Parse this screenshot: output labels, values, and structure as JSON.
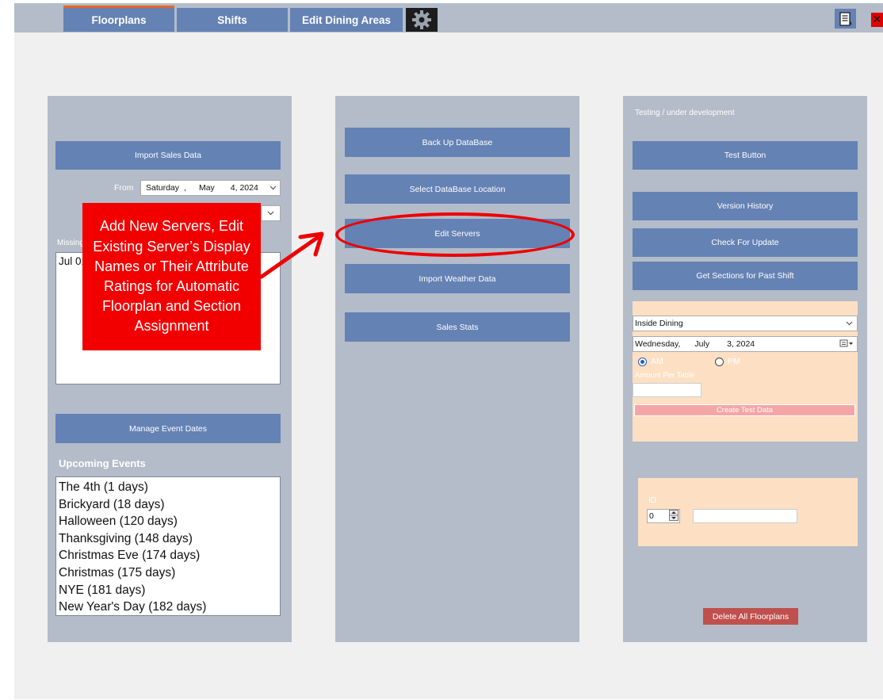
{
  "tabs": [
    {
      "label": "Floorplans"
    },
    {
      "label": "Shifts"
    },
    {
      "label": "Edit Dining Areas"
    }
  ],
  "icons": {
    "settings": "gear-icon",
    "notes": "notes-icon",
    "close": "close-icon"
  },
  "left_panel": {
    "import_button": "Import Sales Data",
    "from_label": "From",
    "from_date": {
      "weekday": "Saturday",
      "sep": ",",
      "month": "May",
      "day_year": "4, 2024"
    },
    "missing_label": "Missing",
    "missing_list": [
      "Jul 01"
    ],
    "manage_events_button": "Manage Event Dates",
    "upcoming_title": "Upcoming Events",
    "events": [
      "The 4th (1 days)",
      "Brickyard (18 days)",
      "Halloween (120 days)",
      "Thanksgiving (148 days)",
      "Christmas Eve (174 days)",
      "Christmas (175 days)",
      "NYE (181 days)",
      "New Year's Day (182 days)"
    ]
  },
  "middle_panel": {
    "buttons": [
      "Back Up DataBase",
      "Select DataBase Location",
      "Edit Servers",
      "Import Weather Data",
      "Sales Stats"
    ]
  },
  "right_panel": {
    "testing_label": "Testing / under development",
    "test_button": "Test Button",
    "version_button": "Version History",
    "update_button": "Check For Update",
    "sections_button": "Get Sections for Past Shift",
    "dining_area": "Inside Dining",
    "date": {
      "weekday": "Wednesday,",
      "month": "July",
      "day_year": "3, 2024"
    },
    "am_label": "AM",
    "pm_label": "PM",
    "amount_label": "Amount Per Table",
    "create_button": "Create Test Data",
    "id_label": "ID",
    "id_value": "0",
    "delete_button": "Delete All Floorplans"
  },
  "callout": {
    "text": "Add New Servers, Edit Existing Server’s Display Names or Their Attribute Ratings for Automatic Floorplan and Section Assignment"
  },
  "colors": {
    "tab_blue": "#6582b5",
    "panel_gray": "#b3bcc8",
    "active_tab_accent": "#e8661f",
    "callout_red": "#f20000",
    "peach": "#fde0c3",
    "delete_red": "#c0504d"
  }
}
